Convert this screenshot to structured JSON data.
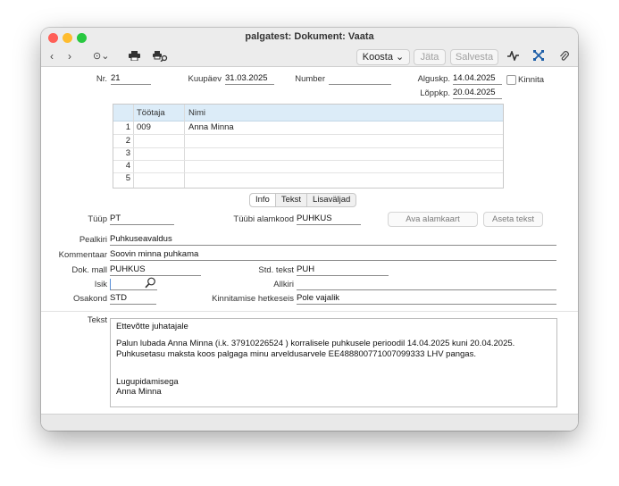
{
  "window": {
    "title": "palgatest: Dokument: Vaata"
  },
  "toolbar": {
    "back_icon": "‹",
    "forward_icon": "›",
    "more_icon": "⊙⌄",
    "print_icon": "print-icon",
    "print_preview_icon": "print-preview-icon",
    "koosta_label": "Koosta",
    "jata_label": "Jäta",
    "salvesta_label": "Salvesta"
  },
  "header": {
    "nr_label": "Nr.",
    "nr_value": "21",
    "kuupaev_label": "Kuupäev",
    "kuupaev_value": "31.03.2025",
    "number_label": "Number",
    "number_value": "",
    "alguskp_label": "Alguskp.",
    "alguskp_value": "14.04.2025",
    "loppkp_label": "Lõppkp.",
    "loppkp_value": "20.04.2025",
    "kinnita_label": "Kinnita"
  },
  "grid": {
    "columns": [
      "Töötaja",
      "Nimi"
    ],
    "rows": [
      {
        "num": "1",
        "tootaja": "009",
        "nimi": "Anna Minna"
      },
      {
        "num": "2",
        "tootaja": "",
        "nimi": ""
      },
      {
        "num": "3",
        "tootaja": "",
        "nimi": ""
      },
      {
        "num": "4",
        "tootaja": "",
        "nimi": ""
      },
      {
        "num": "5",
        "tootaja": "",
        "nimi": ""
      }
    ]
  },
  "tabs": [
    "Info",
    "Tekst",
    "Lisaväljad"
  ],
  "info": {
    "tuup_label": "Tüüp",
    "tuup_value": "PT",
    "alamkood_label": "Tüübi alamkood",
    "alamkood_value": "PUHKUS",
    "ava_alamkaart_label": "Ava alamkaart",
    "aseta_tekst_label": "Aseta tekst",
    "pealkiri_label": "Pealkiri",
    "pealkiri_value": "Puhkuseavaldus",
    "kommentaar_label": "Kommentaar",
    "kommentaar_value": "Soovin minna puhkama",
    "dokmall_label": "Dok. mall",
    "dokmall_value": "PUHKUS",
    "stdtekst_label": "Std. tekst",
    "stdtekst_value": "PUH",
    "isik_label": "Isik",
    "isik_value": "",
    "allkiri_label": "Allkiri",
    "allkiri_value": "",
    "osakond_label": "Osakond",
    "osakond_value": "STD",
    "kinnitamise_label": "Kinnitamise hetkeseis",
    "kinnitamise_value": "Pole vajalik"
  },
  "tekst": {
    "label": "Tekst",
    "lines": [
      "Ettevõtte juhatajale",
      "",
      "Palun lubada Anna Minna  (i.k. 37910226524 ) korralisele puhkusele perioodil 14.04.2025 kuni 20.04.2025.",
      "Puhkusetasu maksta koos palgaga minu arveldusarvele EE488800771007099333 LHV pangas.",
      "",
      "",
      "Lugupidamisega",
      "Anna Minna"
    ]
  },
  "colors": {
    "accent_blue": "#dcecf8",
    "close": "#ff5f57",
    "minimize": "#febc2e",
    "zoom": "#28c840"
  }
}
